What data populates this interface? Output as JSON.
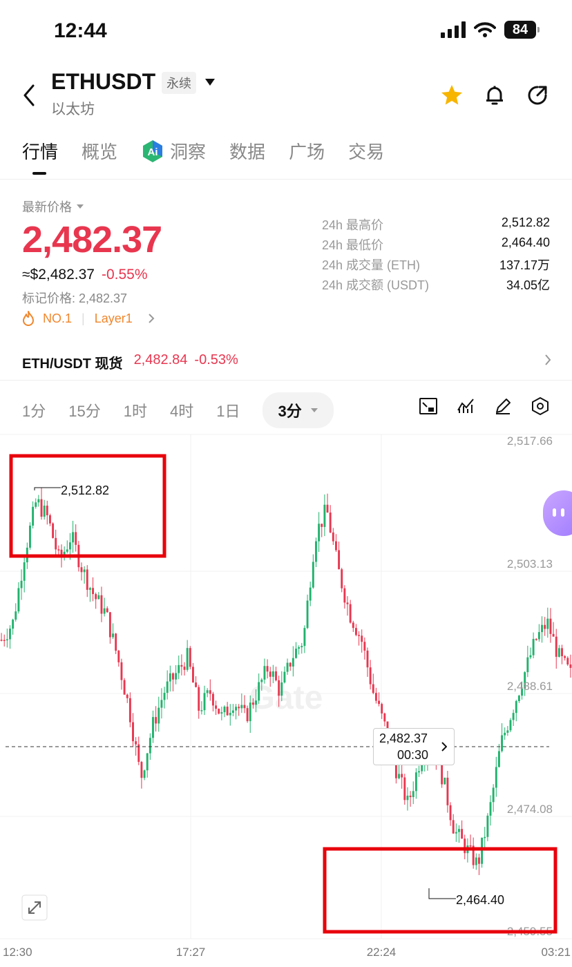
{
  "status_bar": {
    "time": "12:44",
    "battery": "84"
  },
  "header": {
    "symbol": "ETHUSDT",
    "contract_type": "永续",
    "name": "以太坊"
  },
  "tabs": [
    {
      "label": "行情",
      "active": true
    },
    {
      "label": "概览"
    },
    {
      "label": "洞察",
      "icon": "ai-icon"
    },
    {
      "label": "数据"
    },
    {
      "label": "广场"
    },
    {
      "label": "交易"
    }
  ],
  "price": {
    "label": "最新价格",
    "last": "2,482.37",
    "usd": "≈$2,482.37",
    "change": "-0.55%",
    "mark": "标记价格: 2,482.37",
    "rank": "NO.1",
    "tag": "Layer1"
  },
  "stats": [
    {
      "label": "24h 最高价",
      "value": "2,512.82"
    },
    {
      "label": "24h 最低价",
      "value": "2,464.40"
    },
    {
      "label": "24h 成交量 (ETH)",
      "value": "137.17万"
    },
    {
      "label": "24h 成交额 (USDT)",
      "value": "34.05亿"
    }
  ],
  "spot": {
    "label": "ETH/USDT 现货",
    "price": "2,482.84",
    "change": "-0.53%"
  },
  "timeframes": [
    "1分",
    "15分",
    "1时",
    "4时",
    "1日"
  ],
  "active_timeframe": "3分",
  "chart": {
    "y_ticks": [
      "2,517.66",
      "2,503.13",
      "2,488.61",
      "2,474.08",
      "2,459.55"
    ],
    "x_ticks": [
      "12:30",
      "17:27",
      "22:24",
      "03:21"
    ],
    "high_label": "2,512.82",
    "low_label": "2,464.40",
    "current_price": "2,482.37",
    "countdown": "00:30",
    "watermark": "Gate",
    "colors": {
      "up": "#20b26c",
      "down": "#e8364f",
      "highlight_box": "#e8000b"
    }
  },
  "chart_data": {
    "type": "candlestick",
    "x_labels": [
      "12:30",
      "17:27",
      "22:24",
      "03:21"
    ],
    "ylim": [
      2459.55,
      2517.66
    ],
    "high": 2512.82,
    "low": 2464.4,
    "last": 2482.37,
    "close_path": [
      2494,
      2496,
      2504,
      2510,
      2508,
      2503,
      2506,
      2502,
      2499,
      2497,
      2492,
      2486,
      2478,
      2484,
      2488,
      2490,
      2492,
      2486,
      2488,
      2485,
      2487,
      2485,
      2488,
      2491,
      2488,
      2492,
      2494,
      2506,
      2509,
      2502,
      2497,
      2494,
      2488,
      2484,
      2479,
      2475,
      2480,
      2483,
      2478,
      2472,
      2470,
      2468,
      2474,
      2482,
      2486,
      2490,
      2494,
      2496,
      2492,
      2490
    ]
  }
}
